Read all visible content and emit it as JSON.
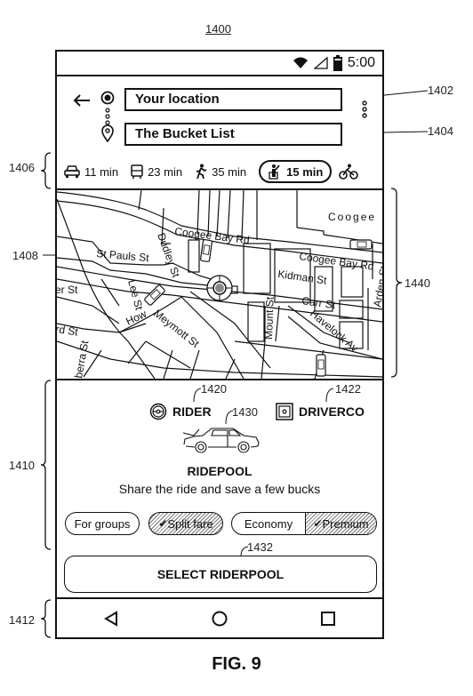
{
  "figure": {
    "number_label": "1400",
    "caption": "FIG. 9",
    "refs": {
      "origin_field": "1402",
      "destination_field": "1404",
      "mode_bar": "1406",
      "map_marker": "1408",
      "ride_panel": "1410",
      "nav_bar": "1412",
      "rider_brand": "1420",
      "driverco_brand": "1422",
      "car_image": "1430",
      "select_button": "1432",
      "map_area": "1440"
    }
  },
  "status_bar": {
    "time": "5:00",
    "icons": [
      "wifi-icon",
      "cell-signal-icon",
      "battery-icon"
    ]
  },
  "header": {
    "back_icon": "arrow-left-icon",
    "origin": {
      "value": "Your location",
      "icon": "origin-dot-icon"
    },
    "destination": {
      "value": "The Bucket List",
      "icon": "location-pin-icon"
    },
    "more_icon": "more-vertical-icon"
  },
  "modes": [
    {
      "icon": "car-icon",
      "label": "11 min",
      "active": false
    },
    {
      "icon": "transit-icon",
      "label": "23 min",
      "active": false
    },
    {
      "icon": "walk-icon",
      "label": "35 min",
      "active": false
    },
    {
      "icon": "rideshare-icon",
      "label": "15 min",
      "active": true
    },
    {
      "icon": "bike-icon",
      "label": "",
      "active": false
    }
  ],
  "map": {
    "street_labels": [
      "Coogee Bay Rd",
      "Coogee Bay Rd",
      "Coogee",
      "Dudley St",
      "St Pauls St",
      "Lee St",
      "er St",
      "How",
      "Meymott St",
      "rd St",
      "berra St",
      "Kidman St",
      "Carr St",
      "Mount St",
      "Havelock Av",
      "Arden St"
    ]
  },
  "panel": {
    "brands": [
      {
        "icon": "rider-logo-icon",
        "label": "RIDER"
      },
      {
        "icon": "driverco-logo-icon",
        "label": "DRIVERCO"
      }
    ],
    "title": "RIDEPOOL",
    "subtitle": "Share the ride and save a few bucks",
    "options": [
      {
        "label": "For groups",
        "selected": false
      },
      {
        "label": "Split fare",
        "selected": true
      }
    ],
    "tier_toggle": [
      {
        "label": "Economy",
        "selected": false
      },
      {
        "label": "Premium",
        "selected": true
      }
    ],
    "select_button": "SELECT RIDERPOOL"
  },
  "navbar": {
    "items": [
      "back-nav-icon",
      "home-nav-icon",
      "recents-nav-icon"
    ]
  }
}
